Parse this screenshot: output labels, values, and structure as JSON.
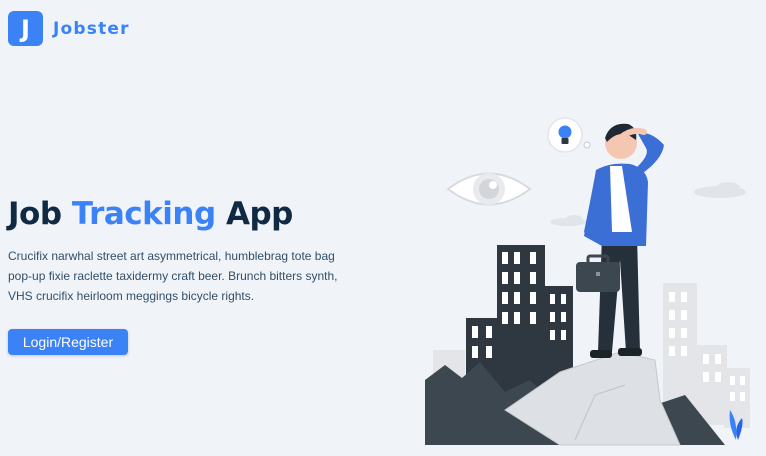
{
  "brand": {
    "logo_letter": "J",
    "name": "Jobster",
    "accent_color": "#3b82f6"
  },
  "hero": {
    "title_part1": "Job",
    "title_accent": "Tracking",
    "title_part2": "App",
    "description": "Crucifix narwhal street art asymmetrical, humblebrag tote bag pop-up fixie raclette taxidermy craft beer. Brunch bitters synth, VHS crucifix heirloom meggings bicycle rights."
  },
  "actions": {
    "login_register_label": "Login/Register"
  },
  "illustration": {
    "icon": "job-search-person-illustration"
  }
}
